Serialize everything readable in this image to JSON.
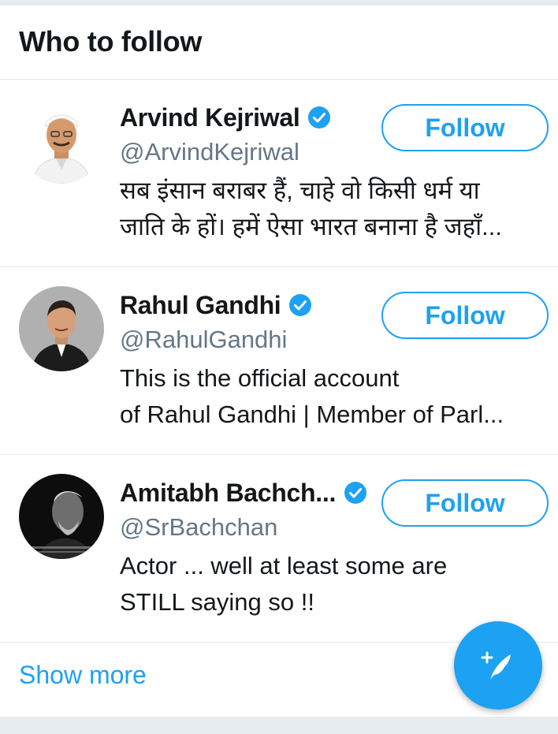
{
  "header": {
    "title": "Who to follow"
  },
  "suggestions": [
    {
      "name": "Arvind Kejriwal",
      "handle": "@ArvindKejriwal",
      "verified": true,
      "follow_label": "Follow",
      "bio_lines": [
        "सब इंसान बराबर हैं, चाहे वो किसी धर्म या",
        "जाति के हों। हमें ऐसा भारत बनाना है जहाँ..."
      ],
      "avatar": "person-white-cap-photo"
    },
    {
      "name": "Rahul Gandhi",
      "handle": "@RahulGandhi",
      "verified": true,
      "follow_label": "Follow",
      "bio_lines": [
        "This is the official account",
        "of Rahul Gandhi | Member of Parl..."
      ],
      "avatar": "person-dark-jacket-photo"
    },
    {
      "name": "Amitabh Bachch...",
      "handle": "@SrBachchan",
      "verified": true,
      "follow_label": "Follow",
      "bio_lines": [
        "Actor ... well at least some are",
        "STILL saying so !!"
      ],
      "avatar": "person-monochrome-photo"
    }
  ],
  "footer": {
    "show_more_label": "Show more"
  },
  "fab": {
    "icon": "compose-tweet-icon"
  },
  "colors": {
    "accent": "#1da1f2",
    "text_primary": "#14171a",
    "text_secondary": "#657786",
    "divider": "#e1e8ed",
    "background": "#e6ecf0"
  }
}
